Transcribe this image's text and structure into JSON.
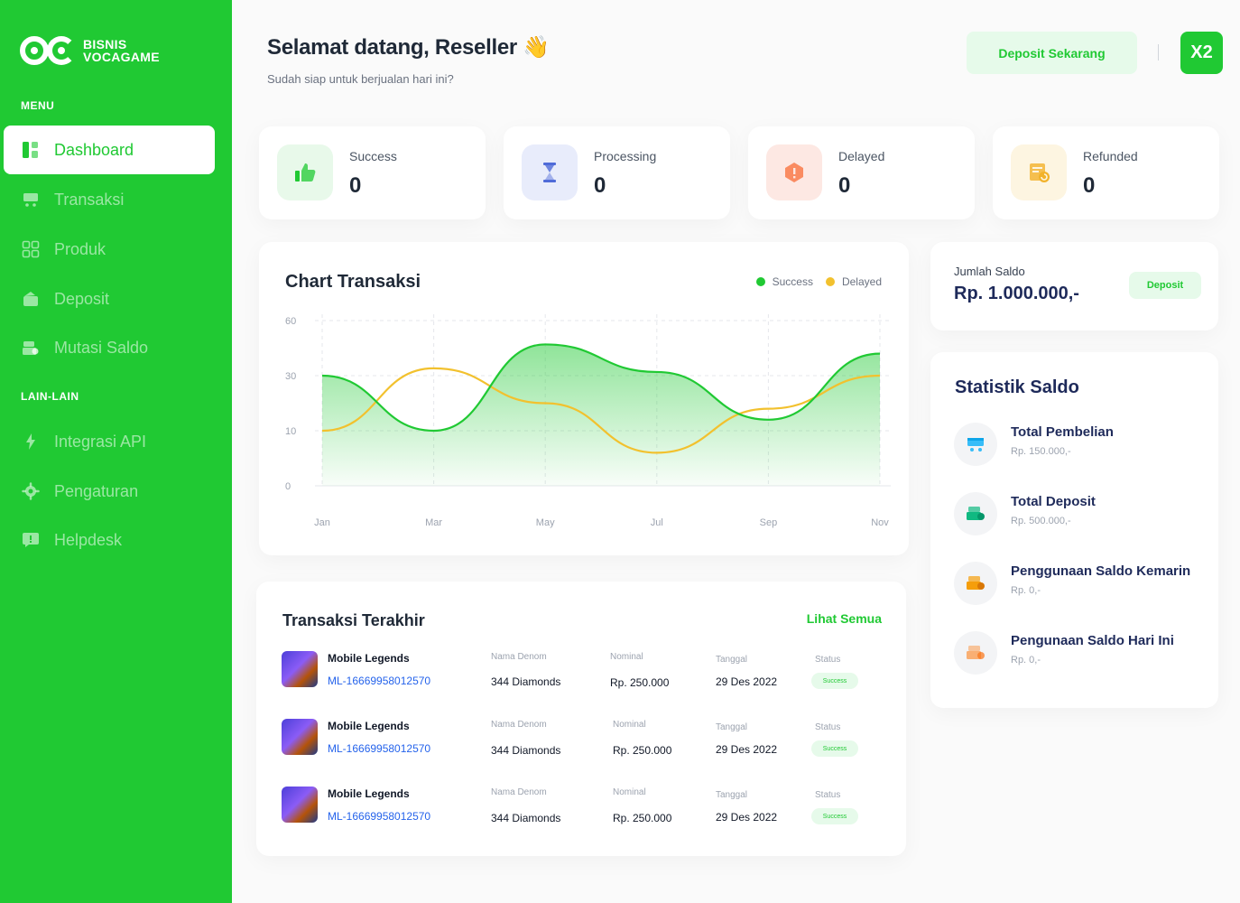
{
  "brand": {
    "line1": "BISNIS",
    "line2": "VOCAGAME"
  },
  "sidebar": {
    "menu_label": "MENU",
    "other_label": "LAIN-LAIN",
    "items": [
      {
        "label": "Dashboard",
        "icon": "dashboard-icon"
      },
      {
        "label": "Transaksi",
        "icon": "cart-icon"
      },
      {
        "label": "Produk",
        "icon": "grid-icon"
      },
      {
        "label": "Deposit",
        "icon": "wallet-icon"
      },
      {
        "label": "Mutasi Saldo",
        "icon": "money-icon"
      }
    ],
    "other_items": [
      {
        "label": "Integrasi API",
        "icon": "bolt-icon"
      },
      {
        "label": "Pengaturan",
        "icon": "gear-icon"
      },
      {
        "label": "Helpdesk",
        "icon": "chat-icon"
      }
    ]
  },
  "header": {
    "greeting": "Selamat datang, Reseller",
    "wave": "👋",
    "subtitle": "Sudah siap untuk berjualan hari ini?",
    "deposit_button": "Deposit Sekarang",
    "avatar_initials": "X2"
  },
  "stats": [
    {
      "label": "Success",
      "value": "0",
      "bg": "#e8f9ea",
      "color": "#20c933"
    },
    {
      "label": "Processing",
      "value": "0",
      "bg": "#e8ecfb",
      "color": "#4f6bd8"
    },
    {
      "label": "Delayed",
      "value": "0",
      "bg": "#fde8e3",
      "color": "#f97a4a"
    },
    {
      "label": "Refunded",
      "value": "0",
      "bg": "#fdf5e1",
      "color": "#f2b22a"
    }
  ],
  "chart": {
    "title": "Chart Transaksi",
    "legend": [
      "Success",
      "Delayed"
    ]
  },
  "chart_data": {
    "type": "area",
    "categories": [
      "Jan",
      "Mar",
      "May",
      "Jul",
      "Sep",
      "Nov"
    ],
    "y_ticks": [
      "60",
      "30",
      "10",
      "0"
    ],
    "series": [
      {
        "name": "Success",
        "color": "#20c933",
        "values": [
          30,
          10,
          47,
          32,
          14,
          42
        ]
      },
      {
        "name": "Delayed",
        "color": "#f2c12e",
        "values": [
          10,
          34,
          20,
          6,
          18,
          30
        ]
      }
    ],
    "grid": true,
    "legend_position": "top-right"
  },
  "transactions": {
    "title": "Transaksi Terakhir",
    "see_all": "Lihat Semua",
    "col_denom": "Nama Denom",
    "col_nominal": "Nominal",
    "col_date": "Tanggal",
    "col_status": "Status",
    "rows": [
      {
        "game": "Mobile Legends",
        "id": "ML-16669958012570",
        "denom": "344 Diamonds",
        "nominal": "Rp. 250.000",
        "date": "29 Des 2022",
        "status": "Success"
      },
      {
        "game": "Mobile Legends",
        "id": "ML-16669958012570",
        "denom": "344 Diamonds",
        "nominal": "Rp. 250.000",
        "date": "29 Des 2022",
        "status": "Success"
      },
      {
        "game": "Mobile Legends",
        "id": "ML-16669958012570",
        "denom": "344 Diamonds",
        "nominal": "Rp. 250.000",
        "date": "29 Des 2022",
        "status": "Success"
      }
    ]
  },
  "saldo": {
    "label": "Jumlah Saldo",
    "value": "Rp. 1.000.000,-",
    "button": "Deposit"
  },
  "statistik": {
    "title": "Statistik Saldo",
    "items": [
      {
        "label": "Total Pembelian",
        "value": "Rp. 150.000,-",
        "icon": "cart-icon",
        "color": "#38bdf8"
      },
      {
        "label": "Total Deposit",
        "value": "Rp. 500.000,-",
        "icon": "money-icon",
        "color": "#10b981"
      },
      {
        "label": "Penggunaan Saldo Kemarin",
        "value": "Rp. 0,-",
        "icon": "money-icon",
        "color": "#f59e0b"
      },
      {
        "label": "Pengunaan Saldo Hari Ini",
        "value": "Rp. 0,-",
        "icon": "money-icon",
        "color": "#fb923c"
      }
    ]
  }
}
